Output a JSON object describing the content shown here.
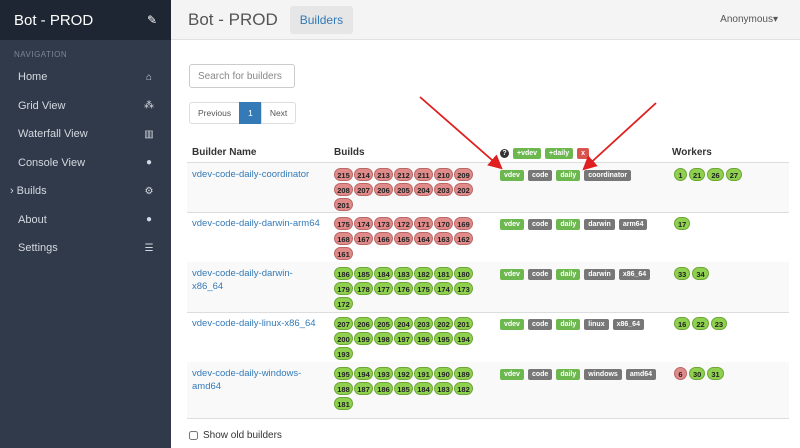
{
  "sidebar": {
    "brand": "Bot - PROD",
    "section_header": "NAVIGATION",
    "items": [
      {
        "label": "Home",
        "icon": "home-icon",
        "glyph": "⌂"
      },
      {
        "label": "Grid View",
        "icon": "cubes-icon",
        "glyph": "⁂"
      },
      {
        "label": "Waterfall View",
        "icon": "bar-chart-icon",
        "glyph": "▥"
      },
      {
        "label": "Console View",
        "icon": "exclamation-circle-icon",
        "glyph": "●"
      },
      {
        "label": "Builds",
        "icon": "cogs-icon",
        "glyph": "⚙",
        "caret": "›"
      },
      {
        "label": "About",
        "icon": "info-circle-icon",
        "glyph": "●"
      },
      {
        "label": "Settings",
        "icon": "sliders-icon",
        "glyph": "☰"
      }
    ]
  },
  "topbar": {
    "title": "Bot - PROD",
    "breadcrumb": "Builders",
    "user": "Anonymous▾"
  },
  "search": {
    "placeholder": "Search for builders"
  },
  "pager": {
    "previous": "Previous",
    "page": "1",
    "next": "Next"
  },
  "table": {
    "headers": {
      "name": "Builder Name",
      "builds": "Builds",
      "workers": "Workers"
    },
    "tag_filter": {
      "help": "?",
      "buttons": [
        "+vdev",
        "+daily"
      ],
      "clear": "x"
    },
    "rows": [
      {
        "name": "vdev-code-daily-coordinator",
        "builds": [
          {
            "n": "215",
            "s": "fail"
          },
          {
            "n": "214",
            "s": "fail"
          },
          {
            "n": "213",
            "s": "fail"
          },
          {
            "n": "212",
            "s": "fail"
          },
          {
            "n": "211",
            "s": "fail"
          },
          {
            "n": "210",
            "s": "fail"
          },
          {
            "n": "209",
            "s": "fail"
          },
          {
            "n": "208",
            "s": "fail"
          },
          {
            "n": "207",
            "s": "fail"
          },
          {
            "n": "206",
            "s": "fail"
          },
          {
            "n": "205",
            "s": "fail"
          },
          {
            "n": "204",
            "s": "fail"
          },
          {
            "n": "203",
            "s": "fail"
          },
          {
            "n": "202",
            "s": "fail"
          },
          {
            "n": "201",
            "s": "fail"
          }
        ],
        "tags": [
          {
            "t": "vdev",
            "c": "g"
          },
          {
            "t": "code",
            "c": "d"
          },
          {
            "t": "daily",
            "c": "g"
          },
          {
            "t": "coordinator",
            "c": "d"
          }
        ],
        "workers": [
          {
            "n": "1",
            "s": "ok"
          },
          {
            "n": "21",
            "s": "ok"
          },
          {
            "n": "26",
            "s": "ok"
          },
          {
            "n": "27",
            "s": "ok"
          }
        ]
      },
      {
        "name": "vdev-code-daily-darwin-arm64",
        "builds": [
          {
            "n": "175",
            "s": "fail"
          },
          {
            "n": "174",
            "s": "fail"
          },
          {
            "n": "173",
            "s": "fail"
          },
          {
            "n": "172",
            "s": "fail"
          },
          {
            "n": "171",
            "s": "fail"
          },
          {
            "n": "170",
            "s": "fail"
          },
          {
            "n": "169",
            "s": "fail"
          },
          {
            "n": "168",
            "s": "fail"
          },
          {
            "n": "167",
            "s": "fail"
          },
          {
            "n": "166",
            "s": "fail"
          },
          {
            "n": "165",
            "s": "fail"
          },
          {
            "n": "164",
            "s": "fail"
          },
          {
            "n": "163",
            "s": "fail"
          },
          {
            "n": "162",
            "s": "fail"
          },
          {
            "n": "161",
            "s": "fail"
          }
        ],
        "tags": [
          {
            "t": "vdev",
            "c": "g"
          },
          {
            "t": "code",
            "c": "d"
          },
          {
            "t": "daily",
            "c": "g"
          },
          {
            "t": "darwin",
            "c": "d"
          },
          {
            "t": "arm64",
            "c": "d"
          }
        ],
        "workers": [
          {
            "n": "17",
            "s": "ok"
          }
        ]
      },
      {
        "name": "vdev-code-daily-darwin-x86_64",
        "builds": [
          {
            "n": "186",
            "s": "ok"
          },
          {
            "n": "185",
            "s": "ok"
          },
          {
            "n": "184",
            "s": "ok"
          },
          {
            "n": "183",
            "s": "ok"
          },
          {
            "n": "182",
            "s": "ok"
          },
          {
            "n": "181",
            "s": "ok"
          },
          {
            "n": "180",
            "s": "ok"
          },
          {
            "n": "179",
            "s": "ok"
          },
          {
            "n": "178",
            "s": "ok"
          },
          {
            "n": "177",
            "s": "ok"
          },
          {
            "n": "176",
            "s": "ok"
          },
          {
            "n": "175",
            "s": "ok"
          },
          {
            "n": "174",
            "s": "ok"
          },
          {
            "n": "173",
            "s": "ok"
          },
          {
            "n": "172",
            "s": "ok"
          }
        ],
        "tags": [
          {
            "t": "vdev",
            "c": "g"
          },
          {
            "t": "code",
            "c": "d"
          },
          {
            "t": "daily",
            "c": "g"
          },
          {
            "t": "darwin",
            "c": "d"
          },
          {
            "t": "x86_64",
            "c": "d"
          }
        ],
        "workers": [
          {
            "n": "33",
            "s": "ok"
          },
          {
            "n": "34",
            "s": "ok"
          }
        ]
      },
      {
        "name": "vdev-code-daily-linux-x86_64",
        "builds": [
          {
            "n": "207",
            "s": "ok"
          },
          {
            "n": "206",
            "s": "ok"
          },
          {
            "n": "205",
            "s": "ok"
          },
          {
            "n": "204",
            "s": "ok"
          },
          {
            "n": "203",
            "s": "ok"
          },
          {
            "n": "202",
            "s": "ok"
          },
          {
            "n": "201",
            "s": "ok"
          },
          {
            "n": "200",
            "s": "ok"
          },
          {
            "n": "199",
            "s": "ok"
          },
          {
            "n": "198",
            "s": "ok"
          },
          {
            "n": "197",
            "s": "ok"
          },
          {
            "n": "196",
            "s": "ok"
          },
          {
            "n": "195",
            "s": "ok"
          },
          {
            "n": "194",
            "s": "ok"
          },
          {
            "n": "193",
            "s": "ok"
          }
        ],
        "tags": [
          {
            "t": "vdev",
            "c": "g"
          },
          {
            "t": "code",
            "c": "d"
          },
          {
            "t": "daily",
            "c": "g"
          },
          {
            "t": "linux",
            "c": "d"
          },
          {
            "t": "x86_64",
            "c": "d"
          }
        ],
        "workers": [
          {
            "n": "16",
            "s": "ok"
          },
          {
            "n": "22",
            "s": "ok"
          },
          {
            "n": "23",
            "s": "ok"
          }
        ]
      },
      {
        "name": "vdev-code-daily-windows-amd64",
        "builds": [
          {
            "n": "195",
            "s": "ok"
          },
          {
            "n": "194",
            "s": "ok"
          },
          {
            "n": "193",
            "s": "ok"
          },
          {
            "n": "192",
            "s": "ok"
          },
          {
            "n": "191",
            "s": "ok"
          },
          {
            "n": "190",
            "s": "ok"
          },
          {
            "n": "189",
            "s": "ok"
          },
          {
            "n": "188",
            "s": "ok"
          },
          {
            "n": "187",
            "s": "ok"
          },
          {
            "n": "186",
            "s": "ok"
          },
          {
            "n": "185",
            "s": "ok"
          },
          {
            "n": "184",
            "s": "ok"
          },
          {
            "n": "183",
            "s": "ok"
          },
          {
            "n": "182",
            "s": "ok"
          },
          {
            "n": "181",
            "s": "ok"
          }
        ],
        "tags": [
          {
            "t": "vdev",
            "c": "g"
          },
          {
            "t": "code",
            "c": "d"
          },
          {
            "t": "daily",
            "c": "g"
          },
          {
            "t": "windows",
            "c": "d"
          },
          {
            "t": "amd64",
            "c": "d"
          }
        ],
        "workers": [
          {
            "n": "6",
            "s": "fail"
          },
          {
            "n": "30",
            "s": "ok"
          },
          {
            "n": "31",
            "s": "ok"
          }
        ]
      }
    ]
  },
  "show_old": {
    "label": "Show old builders"
  },
  "colors": {
    "sidebar": "#313a4a",
    "brand_bg": "#1f2633",
    "link": "#337ab7",
    "success": "#8fd14f",
    "failure": "#e08a8a",
    "annotation_arrow": "#e02020"
  }
}
